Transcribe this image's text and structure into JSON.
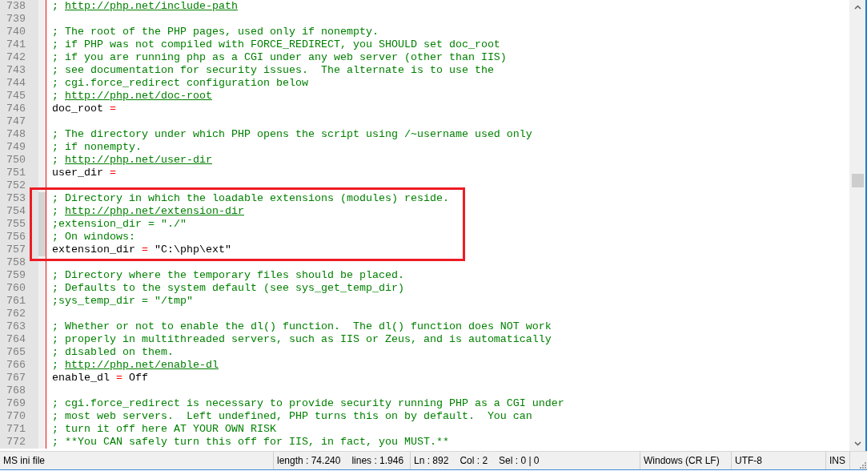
{
  "editor": {
    "lines": [
      {
        "num": "738",
        "kind": "comment",
        "text": "; ",
        "link": "http://php.net/include-path",
        "highlighted": false
      },
      {
        "num": "739",
        "kind": "blank",
        "highlighted": false
      },
      {
        "num": "740",
        "kind": "comment",
        "text": "; The root of the PHP pages, used only if nonempty.",
        "highlighted": false
      },
      {
        "num": "741",
        "kind": "comment",
        "text": "; if PHP was not compiled with FORCE_REDIRECT, you SHOULD set doc_root",
        "highlighted": false
      },
      {
        "num": "742",
        "kind": "comment",
        "text": "; if you are running php as a CGI under any web server (other than IIS)",
        "highlighted": false
      },
      {
        "num": "743",
        "kind": "comment",
        "text": "; see documentation for security issues.  The alternate is to use the",
        "highlighted": false
      },
      {
        "num": "744",
        "kind": "comment",
        "text": "; cgi.force_redirect configuration below",
        "highlighted": false
      },
      {
        "num": "745",
        "kind": "comment",
        "text": "; ",
        "link": "http://php.net/doc-root",
        "highlighted": false
      },
      {
        "num": "746",
        "kind": "setting",
        "key": "doc_root",
        "op": "=",
        "highlighted": false
      },
      {
        "num": "747",
        "kind": "blank",
        "highlighted": false
      },
      {
        "num": "748",
        "kind": "comment",
        "text": "; The directory under which PHP opens the script using /~username used only",
        "highlighted": false
      },
      {
        "num": "749",
        "kind": "comment",
        "text": "; if nonempty.",
        "highlighted": false
      },
      {
        "num": "750",
        "kind": "comment",
        "text": "; ",
        "link": "http://php.net/user-dir",
        "highlighted": false
      },
      {
        "num": "751",
        "kind": "setting",
        "key": "user_dir",
        "op": "=",
        "highlighted": false
      },
      {
        "num": "752",
        "kind": "blank",
        "highlighted": false
      },
      {
        "num": "753",
        "kind": "comment",
        "text": "; Directory in which the loadable extensions (modules) reside.",
        "highlighted": true
      },
      {
        "num": "754",
        "kind": "comment",
        "text": "; ",
        "link": "http://php.net/extension-dir",
        "highlighted": true
      },
      {
        "num": "755",
        "kind": "comment",
        "text": ";extension_dir = \"./\"",
        "highlighted": true
      },
      {
        "num": "756",
        "kind": "comment",
        "text": "; On windows:",
        "highlighted": true
      },
      {
        "num": "757",
        "kind": "setting",
        "key": "extension_dir",
        "op": "=",
        "value": "\"C:\\php\\ext\"",
        "highlighted": true
      },
      {
        "num": "758",
        "kind": "blank",
        "highlighted": false
      },
      {
        "num": "759",
        "kind": "comment",
        "text": "; Directory where the temporary files should be placed.",
        "highlighted": false
      },
      {
        "num": "760",
        "kind": "comment",
        "text": "; Defaults to the system default (see sys_get_temp_dir)",
        "highlighted": false
      },
      {
        "num": "761",
        "kind": "comment",
        "text": ";sys_temp_dir = \"/tmp\"",
        "highlighted": false
      },
      {
        "num": "762",
        "kind": "blank",
        "highlighted": false
      },
      {
        "num": "763",
        "kind": "comment",
        "text": "; Whether or not to enable the dl() function.  The dl() function does NOT work",
        "highlighted": false
      },
      {
        "num": "764",
        "kind": "comment",
        "text": "; properly in multithreaded servers, such as IIS or Zeus, and is automatically",
        "highlighted": false
      },
      {
        "num": "765",
        "kind": "comment",
        "text": "; disabled on them.",
        "highlighted": false
      },
      {
        "num": "766",
        "kind": "comment",
        "text": "; ",
        "link": "http://php.net/enable-dl",
        "highlighted": false
      },
      {
        "num": "767",
        "kind": "setting",
        "key": "enable_dl",
        "op": "=",
        "value": "Off",
        "highlighted": false
      },
      {
        "num": "768",
        "kind": "blank",
        "highlighted": false
      },
      {
        "num": "769",
        "kind": "comment",
        "text": "; cgi.force_redirect is necessary to provide security running PHP as a CGI under",
        "highlighted": false
      },
      {
        "num": "770",
        "kind": "comment",
        "text": "; most web servers.  Left undefined, PHP turns this on by default.  You can",
        "highlighted": false
      },
      {
        "num": "771",
        "kind": "comment",
        "text": "; turn it off here AT YOUR OWN RISK",
        "highlighted": false
      },
      {
        "num": "772",
        "kind": "comment",
        "text": "; **You CAN safely turn this off for IIS, in fact, you MUST.**",
        "highlighted": false
      }
    ]
  },
  "status_bar": {
    "cells": [
      {
        "texts": [
          "MS ini file"
        ]
      },
      {
        "texts": [
          "length : 74.240",
          "lines : 1.946"
        ]
      },
      {
        "texts": [
          "Ln : 892",
          "Col : 2",
          "Sel : 0 | 0"
        ]
      },
      {
        "texts": [
          "Windows (CR LF)"
        ]
      },
      {
        "texts": [
          "UTF-8"
        ]
      },
      {
        "texts": [
          "INS"
        ]
      }
    ]
  }
}
